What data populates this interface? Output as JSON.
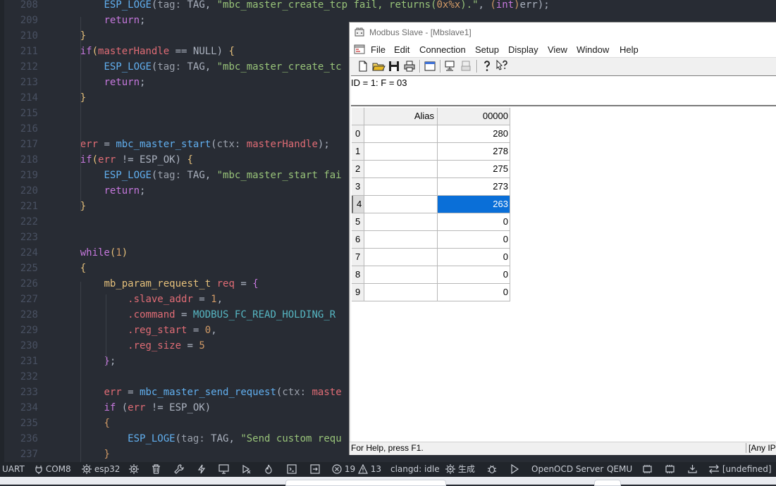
{
  "editor": {
    "lines": [
      {
        "n": "208",
        "tokens": [
          [
            "sp",
            "        "
          ],
          [
            "fn",
            "ESP_LOGE"
          ],
          [
            "pl",
            "("
          ],
          [
            "hint",
            "tag:"
          ],
          [
            "pl",
            " TAG, "
          ],
          [
            "str",
            "\"mbc_master_create_tcp fail, returns("
          ],
          [
            "num",
            "0x%x"
          ],
          [
            "str",
            ")."
          ],
          [
            "str",
            "\""
          ],
          [
            "pl",
            ", "
          ],
          [
            "brk",
            "("
          ],
          [
            "kw",
            "int"
          ],
          [
            "brk",
            ")"
          ],
          [
            "pl",
            "err);"
          ]
        ]
      },
      {
        "n": "209",
        "tokens": [
          [
            "sp",
            "        "
          ],
          [
            "kw",
            "return"
          ],
          [
            "pl",
            ";"
          ]
        ]
      },
      {
        "n": "210",
        "tokens": [
          [
            "sp",
            "    "
          ],
          [
            "par",
            "}"
          ]
        ]
      },
      {
        "n": "211",
        "tokens": [
          [
            "sp",
            "    "
          ],
          [
            "kw",
            "if"
          ],
          [
            "par",
            "("
          ],
          [
            "var",
            "masterHandle"
          ],
          [
            "pl",
            " == NULL) "
          ],
          [
            "par",
            "{"
          ]
        ]
      },
      {
        "n": "212",
        "tokens": [
          [
            "sp",
            "        "
          ],
          [
            "fn",
            "ESP_LOGE"
          ],
          [
            "pl",
            "("
          ],
          [
            "hint",
            "tag:"
          ],
          [
            "pl",
            " TAG, "
          ],
          [
            "str",
            "\"mbc_master_create_tc"
          ]
        ]
      },
      {
        "n": "213",
        "tokens": [
          [
            "sp",
            "        "
          ],
          [
            "kw",
            "return"
          ],
          [
            "pl",
            ";"
          ]
        ]
      },
      {
        "n": "214",
        "tokens": [
          [
            "sp",
            "    "
          ],
          [
            "par",
            "}"
          ]
        ]
      },
      {
        "n": "215",
        "tokens": []
      },
      {
        "n": "216",
        "tokens": []
      },
      {
        "n": "217",
        "tokens": [
          [
            "sp",
            "    "
          ],
          [
            "var",
            "err"
          ],
          [
            "pl",
            " = "
          ],
          [
            "fn",
            "mbc_master_start"
          ],
          [
            "pl",
            "("
          ],
          [
            "hint",
            "ctx:"
          ],
          [
            "pl",
            " "
          ],
          [
            "var",
            "masterHandle"
          ],
          [
            "pl",
            ");"
          ]
        ]
      },
      {
        "n": "218",
        "tokens": [
          [
            "sp",
            "    "
          ],
          [
            "kw",
            "if"
          ],
          [
            "par",
            "("
          ],
          [
            "var",
            "err"
          ],
          [
            "pl",
            " != ESP_OK) "
          ],
          [
            "par",
            "{"
          ]
        ]
      },
      {
        "n": "219",
        "tokens": [
          [
            "sp",
            "        "
          ],
          [
            "fn",
            "ESP_LOGE"
          ],
          [
            "pl",
            "("
          ],
          [
            "hint",
            "tag:"
          ],
          [
            "pl",
            " TAG, "
          ],
          [
            "str",
            "\"mbc_master_start fai"
          ]
        ]
      },
      {
        "n": "220",
        "tokens": [
          [
            "sp",
            "        "
          ],
          [
            "kw",
            "return"
          ],
          [
            "pl",
            ";"
          ]
        ]
      },
      {
        "n": "221",
        "tokens": [
          [
            "sp",
            "    "
          ],
          [
            "par",
            "}"
          ]
        ]
      },
      {
        "n": "222",
        "tokens": []
      },
      {
        "n": "223",
        "tokens": []
      },
      {
        "n": "224",
        "tokens": [
          [
            "sp",
            "    "
          ],
          [
            "kw",
            "while"
          ],
          [
            "par",
            "("
          ],
          [
            "num",
            "1"
          ],
          [
            "par",
            ")"
          ]
        ]
      },
      {
        "n": "225",
        "tokens": [
          [
            "sp",
            "    "
          ],
          [
            "par",
            "{"
          ]
        ]
      },
      {
        "n": "226",
        "tokens": [
          [
            "sp",
            "        "
          ],
          [
            "type",
            "mb_param_request_t"
          ],
          [
            "pl",
            " "
          ],
          [
            "var",
            "req"
          ],
          [
            "pl",
            " = "
          ],
          [
            "kw",
            "{"
          ]
        ]
      },
      {
        "n": "227",
        "tokens": [
          [
            "sp",
            "            "
          ],
          [
            "var",
            ".slave_addr"
          ],
          [
            "pl",
            " = "
          ],
          [
            "num",
            "1"
          ],
          [
            "pl",
            ","
          ]
        ]
      },
      {
        "n": "228",
        "tokens": [
          [
            "sp",
            "            "
          ],
          [
            "var",
            ".command"
          ],
          [
            "pl",
            " = "
          ],
          [
            "con",
            "MODBUS_FC_READ_HOLDING_R"
          ]
        ]
      },
      {
        "n": "229",
        "tokens": [
          [
            "sp",
            "            "
          ],
          [
            "var",
            ".reg_start"
          ],
          [
            "pl",
            " = "
          ],
          [
            "num",
            "0"
          ],
          [
            "pl",
            ","
          ]
        ]
      },
      {
        "n": "230",
        "tokens": [
          [
            "sp",
            "            "
          ],
          [
            "var",
            ".reg_size"
          ],
          [
            "pl",
            " = "
          ],
          [
            "num",
            "5"
          ]
        ]
      },
      {
        "n": "231",
        "tokens": [
          [
            "sp",
            "        "
          ],
          [
            "kw",
            "}"
          ],
          [
            "pl",
            ";"
          ]
        ]
      },
      {
        "n": "232",
        "tokens": []
      },
      {
        "n": "233",
        "tokens": [
          [
            "sp",
            "        "
          ],
          [
            "var",
            "err"
          ],
          [
            "pl",
            " = "
          ],
          [
            "fn",
            "mbc_master_send_request"
          ],
          [
            "pl",
            "("
          ],
          [
            "hint",
            "ctx:"
          ],
          [
            "pl",
            " "
          ],
          [
            "var",
            "maste"
          ]
        ]
      },
      {
        "n": "234",
        "tokens": [
          [
            "sp",
            "        "
          ],
          [
            "kw",
            "if"
          ],
          [
            "pl",
            " ("
          ],
          [
            "var",
            "err"
          ],
          [
            "pl",
            " != ESP_OK)"
          ]
        ]
      },
      {
        "n": "235",
        "tokens": [
          [
            "sp",
            "        "
          ],
          [
            "brk",
            "{"
          ]
        ]
      },
      {
        "n": "236",
        "tokens": [
          [
            "sp",
            "            "
          ],
          [
            "fn",
            "ESP_LOGE"
          ],
          [
            "pl",
            "("
          ],
          [
            "hint",
            "tag:"
          ],
          [
            "pl",
            " TAG, "
          ],
          [
            "str",
            "\"Send custom requ"
          ]
        ]
      },
      {
        "n": "237",
        "tokens": [
          [
            "sp",
            "        "
          ],
          [
            "brk",
            "}"
          ]
        ]
      }
    ]
  },
  "statusbar": {
    "uart": "UART",
    "port": "COM8",
    "target": "esp32",
    "errors": "19",
    "warnings": "13",
    "clangd": "clangd: idle",
    "build": "生成",
    "openocd": "OpenOCD Server",
    "qemu": "QEMU",
    "undefined": "[undefined]"
  },
  "modbus": {
    "title": "Modbus Slave - [Mbslave1]",
    "menu": [
      "File",
      "Edit",
      "Connection",
      "Setup",
      "Display",
      "View",
      "Window",
      "Help"
    ],
    "id_line": "ID = 1: F = 03",
    "columns": {
      "alias": "Alias",
      "address": "00000"
    },
    "rows": [
      {
        "idx": "0",
        "value": "280"
      },
      {
        "idx": "1",
        "value": "278"
      },
      {
        "idx": "2",
        "value": "275"
      },
      {
        "idx": "3",
        "value": "273"
      },
      {
        "idx": "4",
        "value": "263"
      },
      {
        "idx": "5",
        "value": "0"
      },
      {
        "idx": "6",
        "value": "0"
      },
      {
        "idx": "7",
        "value": "0"
      },
      {
        "idx": "8",
        "value": "0"
      },
      {
        "idx": "9",
        "value": "0"
      }
    ],
    "selected_row": 4,
    "status_left": "For Help, press F1.",
    "status_right": "[Any IP"
  },
  "colors": {
    "selection": "#0a6fd8",
    "editor_bg": "#282c34"
  }
}
